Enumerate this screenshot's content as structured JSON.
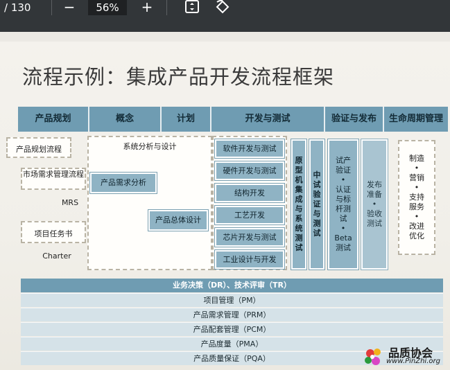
{
  "toolbar": {
    "page_indicator": "/ 130",
    "zoom_out_label": "−",
    "zoom_value": "56%",
    "zoom_in_label": "+",
    "fit_icon": "fit-page-icon",
    "rotate_icon": "rotate-icon"
  },
  "slide": {
    "title": "流程示例：集成产品开发流程框架",
    "headers": [
      "产品规划",
      "概念",
      "计划",
      "开发与测试",
      "验证与发布",
      "生命周期管理"
    ],
    "left_items": [
      "产品规划流程",
      "市场需求管理流程",
      "MRS",
      "项目任务书",
      "Charter"
    ],
    "concept_plan": {
      "top_label": "系统分析与设计",
      "box1": "产品需求分析",
      "box2": "产品总体设计"
    },
    "dev_boxes": [
      "软件开发与测试",
      "硬件开发与测试",
      "结构开发",
      "工艺开发",
      "芯片开发与测试",
      "工业设计与开发"
    ],
    "vertical_1": [
      "原",
      "型",
      "机",
      "集",
      "成",
      "与",
      "系",
      "统",
      "测",
      "试"
    ],
    "vertical_2": [
      "中",
      "试",
      "验",
      "证",
      "与",
      "测",
      "试"
    ],
    "verify_box": [
      "试产",
      "验证",
      "•",
      "认证",
      "与标",
      "杆测",
      "试",
      "•",
      "Beta",
      "测试"
    ],
    "release_box": [
      "发布",
      "准备",
      "•",
      "验收",
      "测试"
    ],
    "lifecycle": [
      "制造",
      "•",
      "营销",
      "•",
      "支持",
      "服务",
      "•",
      "改进",
      "优化"
    ],
    "bands": [
      "业务决策（DR）、技术评审（TR）",
      "项目管理（PM）",
      "产品需求管理（PRM）",
      "产品配套管理（PCM）",
      "产品度量（PMA）",
      "产品质量保证（PQA）"
    ]
  },
  "watermark": {
    "name": "品质协会",
    "url": "www.PinZhi.org"
  },
  "colors": {
    "header_blue": "#6f9cb2",
    "box_blue": "#8fb3c4",
    "band_light": "#d5e2e8",
    "toolbar": "#323639"
  }
}
